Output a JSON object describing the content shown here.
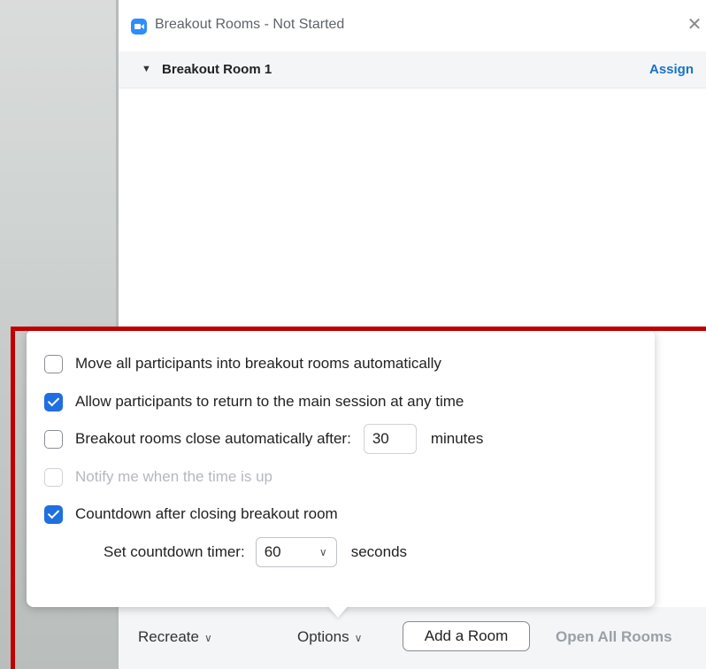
{
  "window": {
    "title": "Breakout Rooms - Not Started",
    "close_glyph": "✕"
  },
  "room": {
    "caret": "▼",
    "name": "Breakout Room 1",
    "assign_label": "Assign"
  },
  "options": [
    {
      "label": "Move all participants into breakout rooms automatically",
      "checked": false,
      "enabled": true
    },
    {
      "label": "Allow participants to return to the main session at any time",
      "checked": true,
      "enabled": true
    },
    {
      "label": "Breakout rooms close automatically after:",
      "checked": false,
      "enabled": true,
      "value": "30",
      "unit": "minutes"
    },
    {
      "label": "Notify me when the time is up",
      "checked": false,
      "enabled": false
    },
    {
      "label": "Countdown after closing breakout room",
      "checked": true,
      "enabled": true
    }
  ],
  "countdown": {
    "label": "Set countdown timer:",
    "selected": "60",
    "unit": "seconds"
  },
  "footer": {
    "recreate_label": "Recreate",
    "options_label": "Options",
    "add_room_label": "Add a Room",
    "open_all_label": "Open All Rooms",
    "chevron": "∨"
  },
  "colors": {
    "accent": "#1f6fe0",
    "link": "#1a73c7",
    "highlight_frame": "#c00000",
    "app_icon": "#2d8cff"
  },
  "icons": {
    "app": "zoom-camera-icon",
    "close": "close-icon",
    "caret": "caret-down-icon",
    "chevron": "chevron-down-icon",
    "check": "checkmark-icon"
  }
}
